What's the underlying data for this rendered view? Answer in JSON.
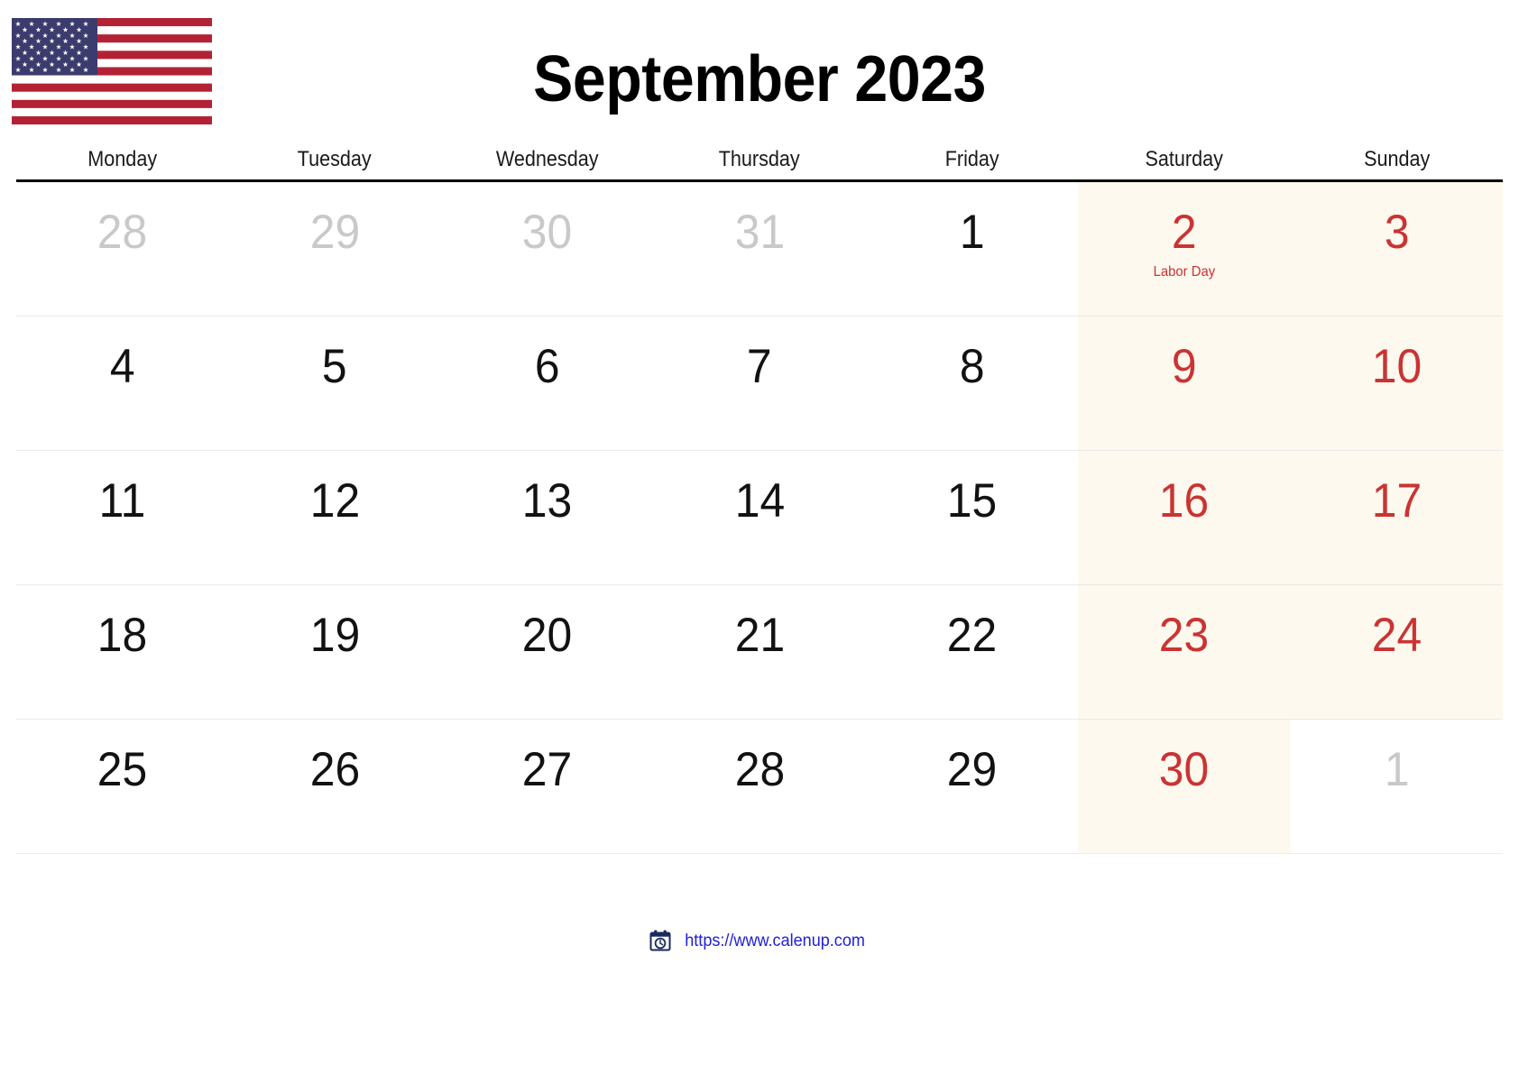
{
  "flag": {
    "name": "us-flag",
    "stripe_red": "#B22234",
    "stripe_white": "#FFFFFF",
    "canton_blue": "#3C3B6E"
  },
  "header": {
    "title": "September 2023",
    "month": "September",
    "year": "2023"
  },
  "colors": {
    "weekend_bg": "#FDF9EE",
    "weekend_text": "#CB3333",
    "weekday_text": "#121212",
    "muted_text": "#C9C9C9",
    "rule": "#000000",
    "row_divider": "#E9E9E9",
    "link": "#2020D8"
  },
  "weekdays": [
    "Monday",
    "Tuesday",
    "Wednesday",
    "Thursday",
    "Friday",
    "Saturday",
    "Sunday"
  ],
  "weeks": [
    [
      {
        "day": "28",
        "style": "muted",
        "highlight": false,
        "event": ""
      },
      {
        "day": "29",
        "style": "muted",
        "highlight": false,
        "event": ""
      },
      {
        "day": "30",
        "style": "muted",
        "highlight": false,
        "event": ""
      },
      {
        "day": "31",
        "style": "muted",
        "highlight": false,
        "event": ""
      },
      {
        "day": "1",
        "style": "normal",
        "highlight": false,
        "event": ""
      },
      {
        "day": "2",
        "style": "red",
        "highlight": true,
        "event": "Labor Day"
      },
      {
        "day": "3",
        "style": "red",
        "highlight": true,
        "event": ""
      }
    ],
    [
      {
        "day": "4",
        "style": "normal",
        "highlight": false,
        "event": ""
      },
      {
        "day": "5",
        "style": "normal",
        "highlight": false,
        "event": ""
      },
      {
        "day": "6",
        "style": "normal",
        "highlight": false,
        "event": ""
      },
      {
        "day": "7",
        "style": "normal",
        "highlight": false,
        "event": ""
      },
      {
        "day": "8",
        "style": "normal",
        "highlight": false,
        "event": ""
      },
      {
        "day": "9",
        "style": "red",
        "highlight": true,
        "event": ""
      },
      {
        "day": "10",
        "style": "red",
        "highlight": true,
        "event": ""
      }
    ],
    [
      {
        "day": "11",
        "style": "normal",
        "highlight": false,
        "event": ""
      },
      {
        "day": "12",
        "style": "normal",
        "highlight": false,
        "event": ""
      },
      {
        "day": "13",
        "style": "normal",
        "highlight": false,
        "event": ""
      },
      {
        "day": "14",
        "style": "normal",
        "highlight": false,
        "event": ""
      },
      {
        "day": "15",
        "style": "normal",
        "highlight": false,
        "event": ""
      },
      {
        "day": "16",
        "style": "red",
        "highlight": true,
        "event": ""
      },
      {
        "day": "17",
        "style": "red",
        "highlight": true,
        "event": ""
      }
    ],
    [
      {
        "day": "18",
        "style": "normal",
        "highlight": false,
        "event": ""
      },
      {
        "day": "19",
        "style": "normal",
        "highlight": false,
        "event": ""
      },
      {
        "day": "20",
        "style": "normal",
        "highlight": false,
        "event": ""
      },
      {
        "day": "21",
        "style": "normal",
        "highlight": false,
        "event": ""
      },
      {
        "day": "22",
        "style": "normal",
        "highlight": false,
        "event": ""
      },
      {
        "day": "23",
        "style": "red",
        "highlight": true,
        "event": ""
      },
      {
        "day": "24",
        "style": "red",
        "highlight": true,
        "event": ""
      }
    ],
    [
      {
        "day": "25",
        "style": "normal",
        "highlight": false,
        "event": ""
      },
      {
        "day": "26",
        "style": "normal",
        "highlight": false,
        "event": ""
      },
      {
        "day": "27",
        "style": "normal",
        "highlight": false,
        "event": ""
      },
      {
        "day": "28",
        "style": "normal",
        "highlight": false,
        "event": ""
      },
      {
        "day": "29",
        "style": "normal",
        "highlight": false,
        "event": ""
      },
      {
        "day": "30",
        "style": "red",
        "highlight": true,
        "event": ""
      },
      {
        "day": "1",
        "style": "muted",
        "highlight": false,
        "event": ""
      }
    ]
  ],
  "footer": {
    "icon": "calendar-clock-icon",
    "url_text": "https://www.calenup.com"
  }
}
